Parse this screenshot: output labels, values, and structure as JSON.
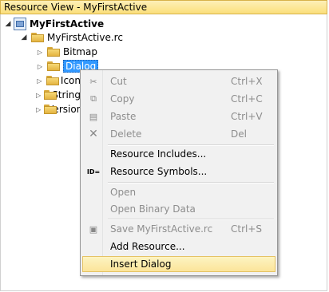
{
  "window": {
    "title": "Resource View - MyFirstActive"
  },
  "tree": {
    "root": "MyFirstActive",
    "rc": "MyFirstActive.rc",
    "items": [
      {
        "label": "Bitmap"
      },
      {
        "label": "Dialog"
      },
      {
        "label": "Icon"
      },
      {
        "label": "String"
      },
      {
        "label": "Version"
      }
    ]
  },
  "context_menu": {
    "cut": {
      "label": "Cut",
      "shortcut": "Ctrl+X"
    },
    "copy": {
      "label": "Copy",
      "shortcut": "Ctrl+C"
    },
    "paste": {
      "label": "Paste",
      "shortcut": "Ctrl+V"
    },
    "delete": {
      "label": "Delete",
      "shortcut": "Del"
    },
    "resource_includes": {
      "label": "Resource Includes..."
    },
    "resource_symbols": {
      "label": "Resource Symbols...",
      "icon_text": "ID="
    },
    "open": {
      "label": "Open"
    },
    "open_binary": {
      "label": "Open Binary Data"
    },
    "save": {
      "label": "Save MyFirstActive.rc",
      "shortcut": "Ctrl+S"
    },
    "add_resource": {
      "label": "Add Resource..."
    },
    "insert_dialog": {
      "label": "Insert Dialog"
    }
  }
}
